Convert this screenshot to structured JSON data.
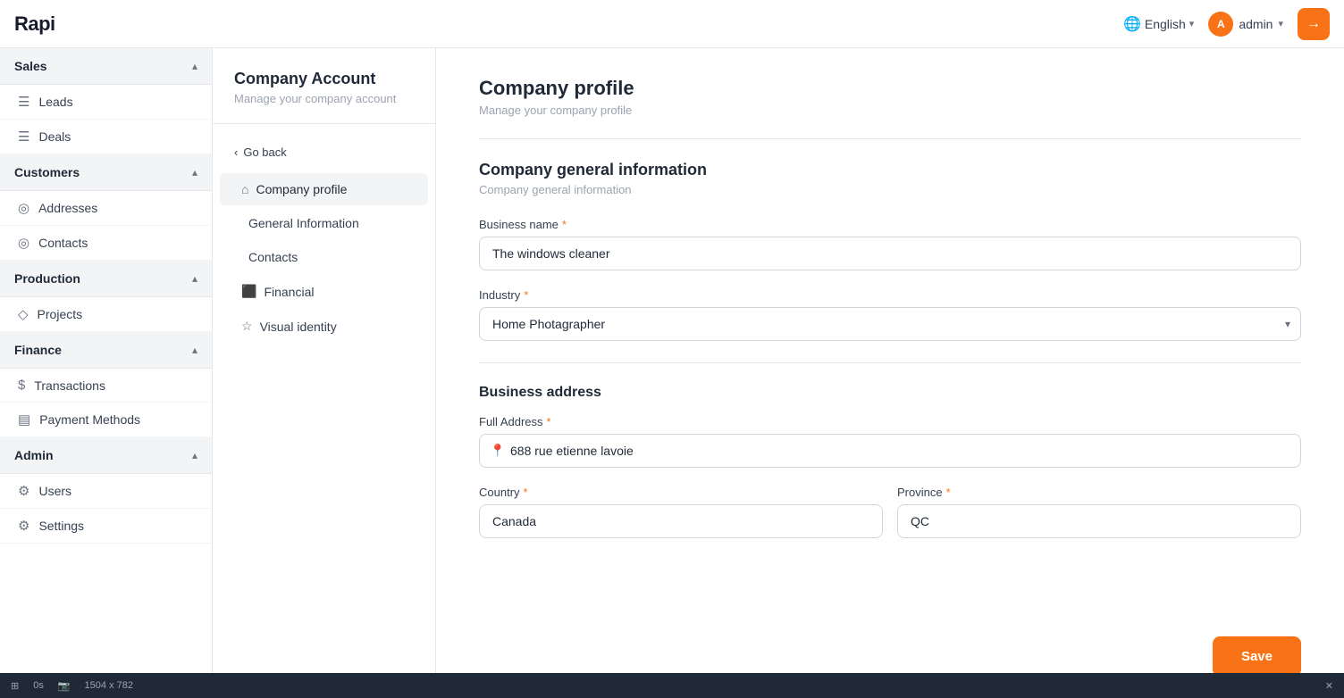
{
  "topbar": {
    "logo": "Rapi",
    "language": "English",
    "user": "admin",
    "icon_btn": "→"
  },
  "sidebar": {
    "sections": [
      {
        "id": "sales",
        "label": "Sales",
        "expanded": true,
        "items": [
          {
            "id": "leads",
            "label": "Leads",
            "icon": "☰"
          },
          {
            "id": "deals",
            "label": "Deals",
            "icon": "☰"
          }
        ]
      },
      {
        "id": "customers",
        "label": "Customers",
        "expanded": true,
        "items": [
          {
            "id": "addresses",
            "label": "Addresses",
            "icon": "◎"
          },
          {
            "id": "contacts",
            "label": "Contacts",
            "icon": "◎"
          }
        ]
      },
      {
        "id": "production",
        "label": "Production",
        "expanded": true,
        "items": [
          {
            "id": "projects",
            "label": "Projects",
            "icon": "◇"
          }
        ]
      },
      {
        "id": "finance",
        "label": "Finance",
        "expanded": true,
        "items": [
          {
            "id": "transactions",
            "label": "Transactions",
            "icon": "$"
          },
          {
            "id": "payment-methods",
            "label": "Payment Methods",
            "icon": "▤"
          }
        ]
      },
      {
        "id": "admin",
        "label": "Admin",
        "expanded": true,
        "items": [
          {
            "id": "users",
            "label": "Users",
            "icon": "⚙"
          },
          {
            "id": "settings",
            "label": "Settings",
            "icon": "⚙"
          }
        ]
      }
    ]
  },
  "secondary_nav": {
    "title": "Company Account",
    "subtitle": "Manage your company account",
    "go_back": "Go back",
    "items": [
      {
        "id": "company-profile",
        "label": "Company profile",
        "icon": "⌂",
        "active": true
      },
      {
        "id": "general-information",
        "label": "General Information",
        "icon": ""
      },
      {
        "id": "contacts",
        "label": "Contacts",
        "icon": ""
      },
      {
        "id": "financial",
        "label": "Financial",
        "icon": "⬛"
      },
      {
        "id": "visual-identity",
        "label": "Visual identity",
        "icon": "☆"
      }
    ]
  },
  "main": {
    "page_title": "Company profile",
    "page_subtitle": "Manage your company profile",
    "section_title": "Company general information",
    "section_subtitle": "Company general information",
    "business_name_label": "Business name",
    "business_name_value": "The windows cleaner",
    "industry_label": "Industry",
    "industry_value": "Home Photagrapher",
    "address_section_title": "Business address",
    "full_address_label": "Full Address",
    "full_address_value": "688 rue etienne lavoie",
    "country_label": "Country",
    "country_value": "Canada",
    "province_label": "Province",
    "province_value": "QC",
    "save_label": "Save"
  },
  "bottombar": {
    "grid": "⊞",
    "time": "0s",
    "camera": "📷",
    "dimensions": "1504 x 782",
    "close": "✕"
  }
}
